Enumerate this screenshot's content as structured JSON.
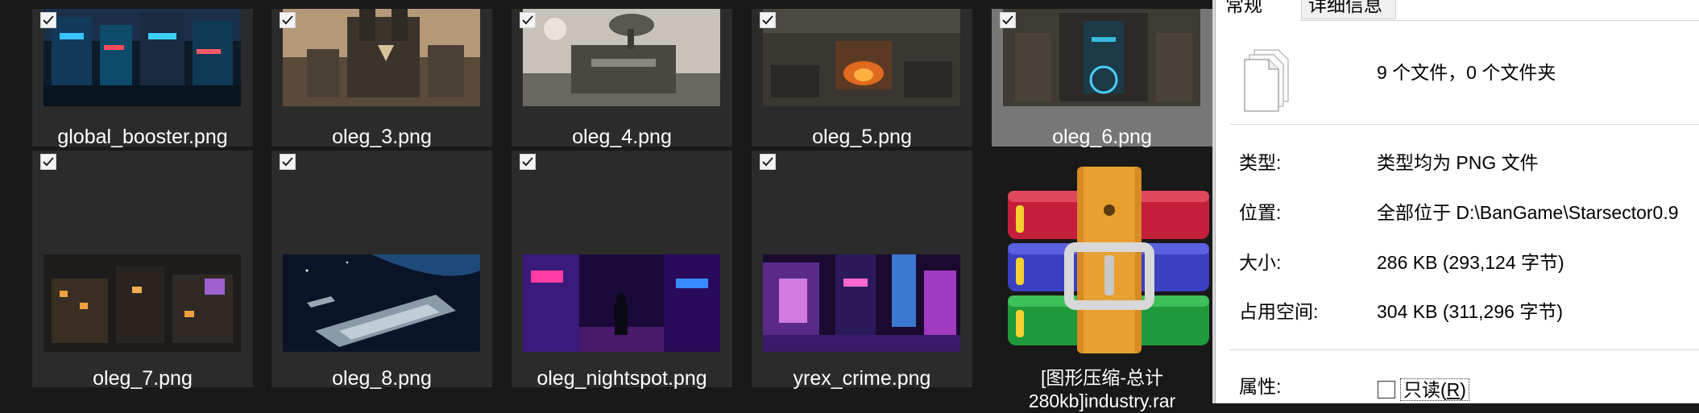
{
  "files": [
    {
      "name": "global_booster.png",
      "row": 1,
      "selected": false,
      "checked": true
    },
    {
      "name": "oleg_3.png",
      "row": 1,
      "selected": false,
      "checked": true
    },
    {
      "name": "oleg_4.png",
      "row": 1,
      "selected": false,
      "checked": true
    },
    {
      "name": "oleg_5.png",
      "row": 1,
      "selected": false,
      "checked": true
    },
    {
      "name": "oleg_6.png",
      "row": 1,
      "selected": true,
      "checked": true
    },
    {
      "name": "oleg_7.png",
      "row": 2,
      "selected": false,
      "checked": true
    },
    {
      "name": "oleg_8.png",
      "row": 2,
      "selected": false,
      "checked": true
    },
    {
      "name": "oleg_nightspot.png",
      "row": 2,
      "selected": false,
      "checked": true
    },
    {
      "name": "yrex_crime.png",
      "row": 2,
      "selected": false,
      "checked": true
    }
  ],
  "archive": {
    "name": "[图形压缩-总计280kb]industry.rar",
    "icon": "winrar-archive-icon"
  },
  "properties": {
    "tabs": [
      "常规",
      "详细信息"
    ],
    "summary": "9 个文件，0 个文件夹",
    "summary_icon": "multiple-files-icon",
    "rows": [
      {
        "label": "类型:",
        "value": "类型均为 PNG 文件"
      },
      {
        "label": "位置:",
        "value": "全部位于 D:\\BanGame\\Starsector0.9"
      },
      {
        "label": "大小:",
        "value": "286 KB (293,124 字节)"
      },
      {
        "label": "占用空间:",
        "value": "304 KB (311,296 字节)"
      }
    ],
    "attributes_label": "属性:",
    "readonly_label": "只读(",
    "readonly_key": "R",
    "readonly_close": ")"
  }
}
